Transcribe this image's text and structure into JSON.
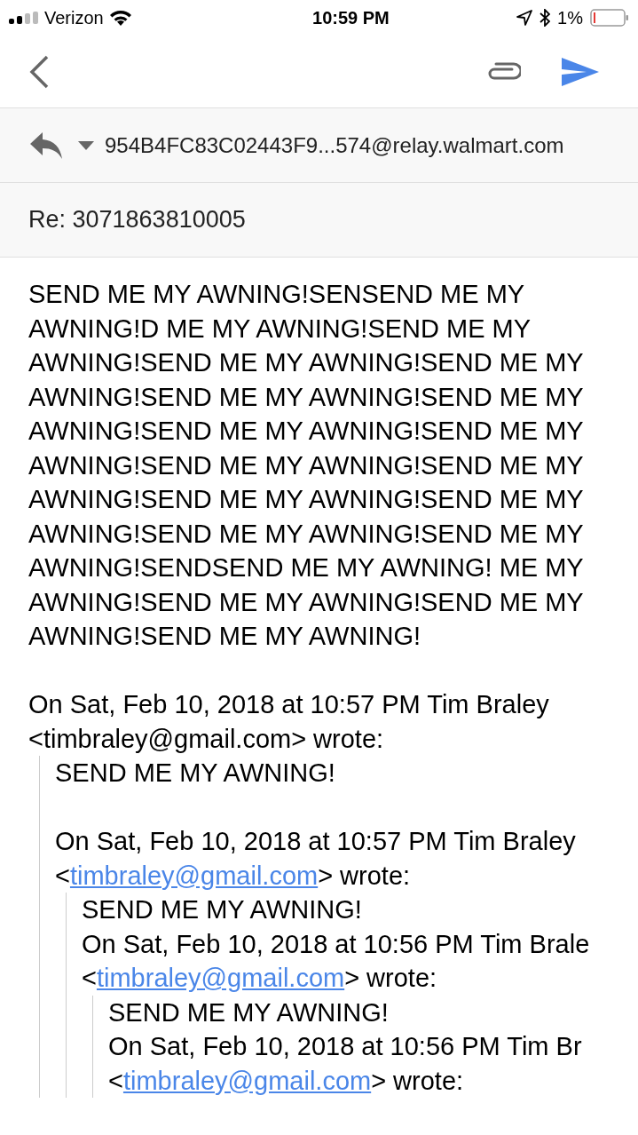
{
  "status_bar": {
    "carrier": "Verizon",
    "time": "10:59 PM",
    "battery": "1%"
  },
  "compose": {
    "recipient": "954B4FC83C02443F9...574@relay.walmart.com",
    "subject": "Re: 3071863810005",
    "body": "SEND ME MY AWNING!SENSEND ME MY AWNING!D ME MY AWNING!SEND ME MY AWNING!SEND ME MY AWNING!SEND ME MY AWNING!SEND ME MY AWNING!SEND ME MY AWNING!SEND ME MY AWNING!SEND ME MY AWNING!SEND ME MY AWNING!SEND ME MY AWNING!SEND ME MY AWNING!SEND ME MY AWNING!SEND ME MY AWNING!SEND ME MY AWNING!SENDSEND ME MY AWNING! ME MY AWNING!SEND ME MY AWNING!SEND ME MY AWNING!SEND ME MY AWNING!",
    "quoted": {
      "attribution": "On Sat, Feb 10, 2018 at 10:57 PM Tim Braley",
      "open": "<",
      "email": "timbraley@gmail.com",
      "linked": false,
      "close": ">",
      "wrote": "wrote:",
      "quote": {
        "body": "SEND ME MY AWNING!",
        "blank_after_body": true,
        "attribution": "On Sat, Feb 10, 2018 at 10:57 PM Tim Braley",
        "open": "<",
        "email": "timbraley@gmail.com",
        "linked": true,
        "close": ">",
        "wrote": "wrote:",
        "quote": {
          "body": "SEND ME MY AWNING!",
          "attribution": "On Sat, Feb 10, 2018 at 10:56 PM Tim Brale",
          "open": "<",
          "email": "timbraley@gmail.com",
          "linked": true,
          "close": ">",
          "wrote": "wrote:",
          "quote": {
            "body": "SEND ME MY AWNING!",
            "attribution": "On Sat, Feb 10, 2018 at 10:56 PM Tim Br",
            "open": "<",
            "email": "timbraley@gmail.com",
            "linked": true,
            "close": ">",
            "wrote": "wrote:"
          }
        }
      }
    }
  }
}
